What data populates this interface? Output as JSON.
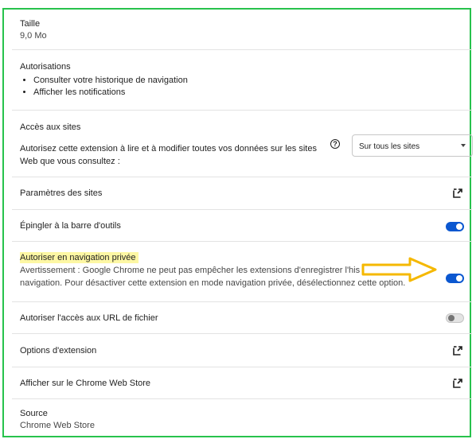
{
  "size": {
    "label": "Taille",
    "value": "9,0 Mo"
  },
  "permissions": {
    "label": "Autorisations",
    "items": [
      "Consulter votre historique de navigation",
      "Afficher les notifications"
    ]
  },
  "site_access": {
    "label": "Accès aux sites",
    "description_line1": "Autorisez cette extension à lire et à modifier toutes vos données sur les sites",
    "description_line2": "Web que vous consultez :",
    "help_glyph": "?",
    "select_value": "Sur tous les sites"
  },
  "site_settings": {
    "label": "Paramètres des sites",
    "icon": "open-in-new-icon"
  },
  "pin_toolbar": {
    "label": "Épingler à la barre d'outils",
    "enabled": true
  },
  "incognito": {
    "label": "Autoriser en navigation privée",
    "warning_line1": "Avertissement : Google Chrome ne peut pas empêcher les extensions d'enregistrer l'his",
    "warning_line2": "navigation. Pour désactiver cette extension en mode navigation privée, désélectionnez cette option.",
    "enabled": true,
    "highlight_color": "#fdf7a4",
    "arrow_color": "#f5b800"
  },
  "file_urls": {
    "label": "Autoriser l'accès aux URL de fichier",
    "enabled": false
  },
  "extension_options": {
    "label": "Options d'extension",
    "icon": "open-in-new-icon"
  },
  "web_store": {
    "label": "Afficher sur le Chrome Web Store",
    "icon": "open-in-new-icon"
  },
  "source": {
    "label": "Source",
    "value": "Chrome Web Store"
  },
  "colors": {
    "accent": "#0b57d0",
    "frame": "#27c24c",
    "divider": "#e3e3e3"
  }
}
